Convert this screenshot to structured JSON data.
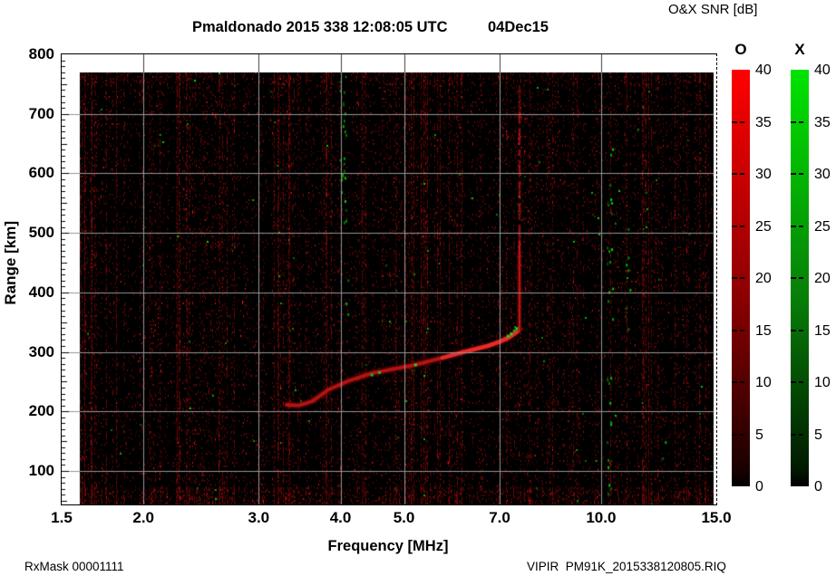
{
  "header": {
    "title": "Pmaldonado 2015 338 12:08:05 UTC",
    "date": "04Dec15",
    "snr_label": "O&X SNR [dB]"
  },
  "footer": {
    "rxmask": "RxMask 00001111",
    "filename": "VIPIR  PM91K_2015338120805.RIQ"
  },
  "colors": {
    "plot_background": "#000000",
    "grid": "#969696",
    "grid_on_white": "#3c3c3c",
    "o_mode": "#ff0000",
    "x_mode": "#00e400",
    "axis": "#000000"
  },
  "chart_data": {
    "type": "heatmap",
    "title": "Pmaldonado 2015 338 12:08:05 UTC  04Dec15",
    "x_axis": {
      "label": "Frequency [MHz]",
      "scale": "log",
      "min": 1.5,
      "max": 15.0,
      "ticks": [
        1.5,
        2.0,
        3.0,
        4.0,
        5.0,
        7.0,
        10.0,
        15.0
      ],
      "tick_labels": [
        "1.5",
        "2.0",
        "3.0",
        "4.0",
        "5.0",
        "7.0",
        "10.0",
        "15.0"
      ],
      "grid_at": [
        2.0,
        3.0,
        4.0,
        5.0,
        7.0,
        10.0
      ]
    },
    "y_axis": {
      "label": "Range [km]",
      "min": 45,
      "max": 800,
      "ticks": [
        800,
        700,
        600,
        500,
        400,
        300,
        200,
        100
      ],
      "tick_labels": [
        "800",
        "700",
        "600",
        "500",
        "400",
        "300",
        "200",
        "100"
      ],
      "minor_tick_step": 10,
      "grid_step": 100
    },
    "colorbars": [
      {
        "name": "O",
        "mode": "ordinary",
        "top_color": "#ff0000",
        "min": 0,
        "max": 40,
        "tick_step": 5,
        "tick_labels": [
          "40",
          "35",
          "30",
          "25",
          "20",
          "15",
          "10",
          "5",
          "0"
        ]
      },
      {
        "name": "X",
        "mode": "extraordinary",
        "top_color": "#00e400",
        "min": 0,
        "max": 40,
        "tick_step": 5,
        "tick_labels": [
          "40",
          "35",
          "30",
          "25",
          "20",
          "15",
          "10",
          "5",
          "0"
        ]
      }
    ],
    "data_extent": {
      "freq_mhz": [
        1.6,
        14.85
      ],
      "range_km": [
        45,
        770
      ]
    },
    "o_trace_points_mhz_km": [
      [
        3.31,
        211
      ],
      [
        3.45,
        210
      ],
      [
        3.62,
        217
      ],
      [
        3.84,
        237
      ],
      [
        4.13,
        252
      ],
      [
        4.46,
        264
      ],
      [
        4.8,
        271
      ],
      [
        5.19,
        278
      ],
      [
        5.72,
        290
      ],
      [
        6.23,
        301
      ],
      [
        6.71,
        310
      ],
      [
        7.0,
        317
      ],
      [
        7.25,
        325
      ],
      [
        7.45,
        334
      ]
    ],
    "critical_asymptote": {
      "freq_mhz": 7.5,
      "km_from": 334,
      "km_to": 765
    },
    "x_trace_green_dots_mhz_km": [
      [
        4.46,
        262
      ],
      [
        4.58,
        266
      ],
      [
        5.2,
        279
      ],
      [
        7.2,
        327
      ],
      [
        7.28,
        331
      ],
      [
        7.36,
        336
      ],
      [
        7.42,
        340
      ]
    ],
    "green_bands": [
      {
        "freq_mhz": 4.03,
        "km_range": [
          510,
          760
        ],
        "density": 0.22
      },
      {
        "freq_mhz": 4.06,
        "km_range": [
          350,
          520
        ],
        "density": 0.06
      },
      {
        "freq_mhz": 10.3,
        "km_range": [
          60,
          645
        ],
        "density": 0.16
      },
      {
        "freq_mhz": 10.95,
        "km_range": [
          310,
          580
        ],
        "density": 0.12
      },
      {
        "freq_mhz": 12.4,
        "km_range": [
          60,
          200
        ],
        "density": 0.04
      }
    ],
    "noise": {
      "seed": 42,
      "red_speck_base_density": 0.16,
      "bright_streak_fraction": 0.1,
      "green_speck_fraction": 0.004,
      "x_mode_diffuse_band_mhz": [
        7.45,
        7.95
      ]
    }
  }
}
